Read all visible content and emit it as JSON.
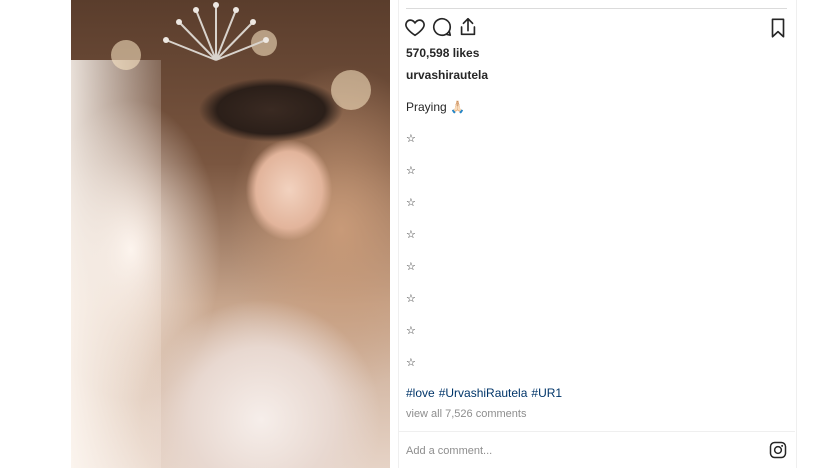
{
  "post": {
    "likes": "570,598 likes",
    "username": "urvashirautela",
    "caption": "Praying 🙏🏻",
    "caption_lines": [
      "☆",
      "☆",
      "☆",
      "☆",
      "☆",
      "☆",
      "☆",
      "☆"
    ],
    "hashtags": [
      "#love",
      "#UrvashiRautela",
      "#UR1"
    ],
    "view_comments": "view all 7,526 comments",
    "comment_placeholder": "Add a comment..."
  },
  "icons": {
    "like": "heart-icon",
    "comment": "comment-icon",
    "share": "share-icon",
    "save": "bookmark-icon",
    "brand": "instagram-icon"
  },
  "colors": {
    "text": "#262626",
    "muted": "#8e8e8e",
    "hashtag": "#003569",
    "border": "#efefef"
  }
}
